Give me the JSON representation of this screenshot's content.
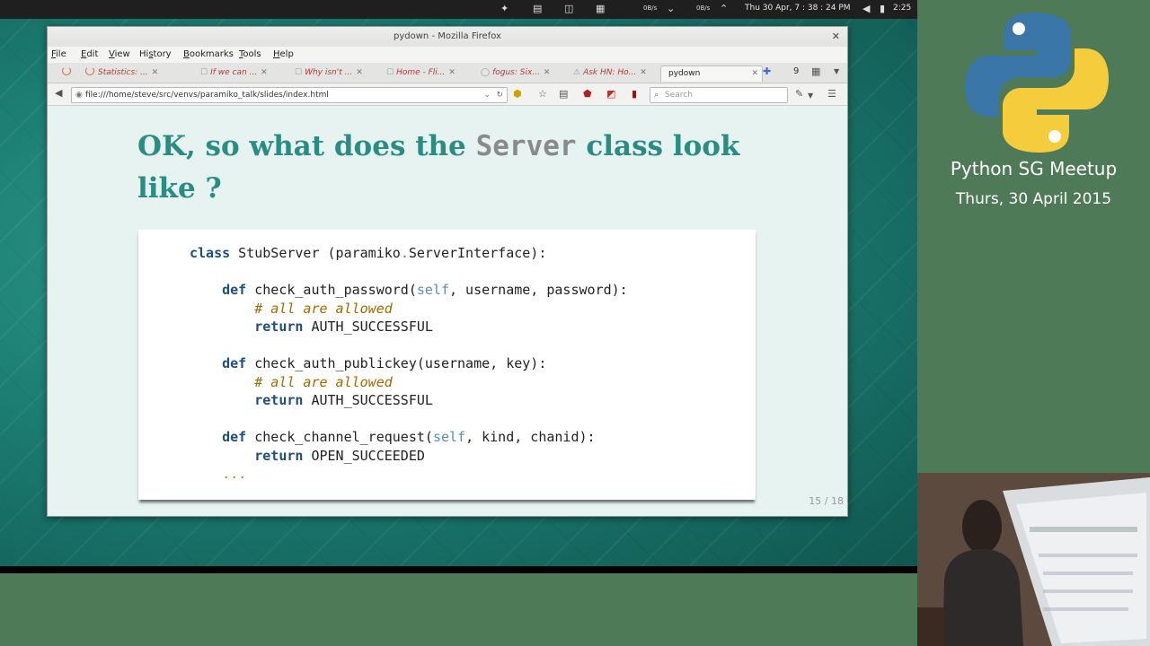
{
  "system_bar": {
    "net1": "0B/s",
    "net2": "0B/s",
    "clock": "Thu 30 Apr, 7 : 38 : 24 PM",
    "time": "2:25"
  },
  "window": {
    "title": "pydown - Mozilla Firefox"
  },
  "menu": [
    {
      "rest": "ile",
      "key": "F"
    },
    {
      "rest": "dit",
      "key": "E"
    },
    {
      "rest": "iew",
      "key": "V"
    },
    {
      "pre": "Hi",
      "key": "s",
      "rest": "tory"
    },
    {
      "rest": "ookmarks",
      "key": "B"
    },
    {
      "rest": "ools",
      "key": "T"
    },
    {
      "rest": "elp",
      "key": "H"
    }
  ],
  "tabs": [
    {
      "label": "Statistics: ..."
    },
    {
      "label": "If we can ..."
    },
    {
      "label": "Why isn't ..."
    },
    {
      "label": "Home - Fli..."
    },
    {
      "label": "fogus: Six..."
    },
    {
      "label": "Ask HN: Ho..."
    },
    {
      "label": "pydown"
    }
  ],
  "tab_count": "9",
  "nav": {
    "url": "file:///home/steve/src/venvs/paramiko_talk/slides/index.html",
    "search_placeholder": "Search"
  },
  "slide": {
    "title_pre": "OK, so what does the ",
    "title_code": "Server",
    "title_post": " class look like ?",
    "page": "15 / 18",
    "code": {
      "l1_kw": "class",
      "l1_a": " StubServer (paramiko",
      "l1_dot": ".",
      "l1_b": "ServerInterface):",
      "def": "def",
      "return": "return",
      "f1_name": "check_auth_password(",
      "self": "self",
      "f1_args": ", username, password):",
      "comment": "# all are allowed",
      "auth_ok": " AUTH_SUCCESSFUL",
      "f2_name": "check_auth_publickey(username, key):",
      "f3_name": "check_channel_request(",
      "f3_args": ", kind, chanid):",
      "open_ok": " OPEN_SUCCEEDED",
      "ellipsis": "..."
    }
  },
  "sidebar": {
    "title": "Python SG Meetup",
    "date": "Thurs, 30 April 2015"
  },
  "colors": {
    "slide_title": "#2a8c83",
    "side_panel": "#4e7a57",
    "python_blue": "#3b76a8",
    "python_yellow": "#f5cc3c"
  }
}
